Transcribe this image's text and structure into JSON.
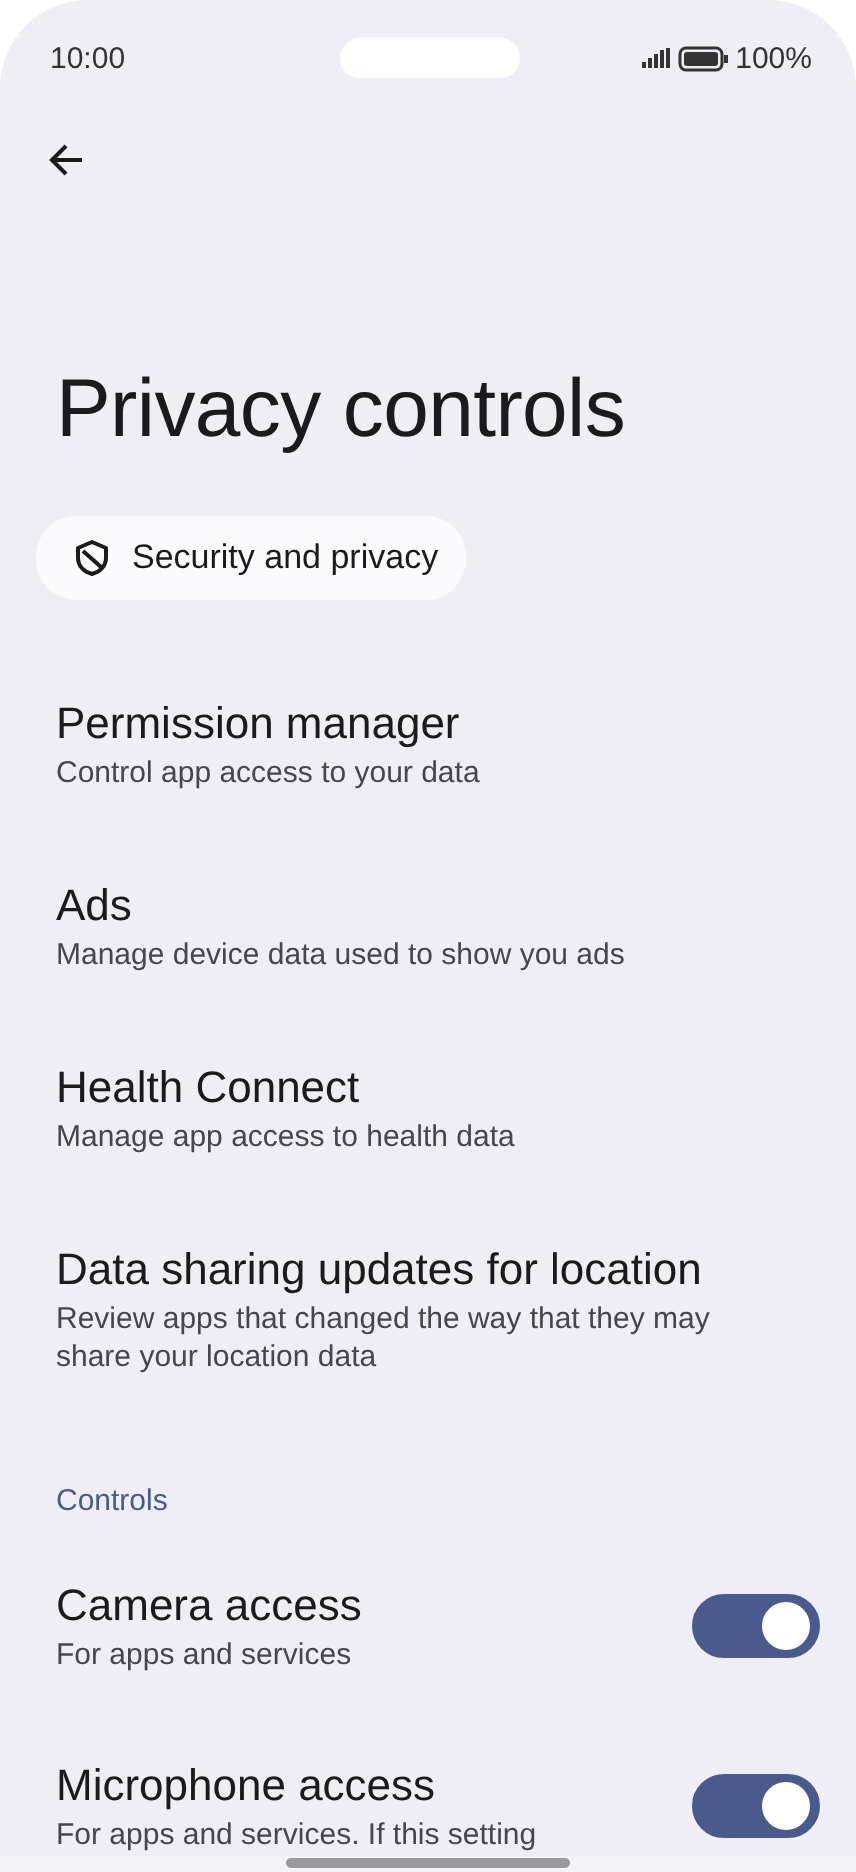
{
  "status_bar": {
    "time": "10:00",
    "battery": "100%"
  },
  "title": "Privacy controls",
  "breadcrumb": {
    "label": "Security and privacy"
  },
  "items": [
    {
      "kind": "link",
      "title": "Permission manager",
      "subtitle": "Control app access to your data"
    },
    {
      "kind": "link",
      "title": "Ads",
      "subtitle": "Manage device data used to show you ads"
    },
    {
      "kind": "link",
      "title": "Health Connect",
      "subtitle": "Manage app access to health data"
    },
    {
      "kind": "link",
      "title": "Data sharing updates for location",
      "subtitle": "Review apps that changed the way that they may share your location data"
    },
    {
      "kind": "header",
      "title": "Controls"
    },
    {
      "kind": "toggle",
      "title": "Camera access",
      "subtitle": "For apps and services",
      "on": true
    },
    {
      "kind": "toggle",
      "title": "Microphone access",
      "subtitle": "For apps and services. If this setting",
      "on": true
    }
  ]
}
